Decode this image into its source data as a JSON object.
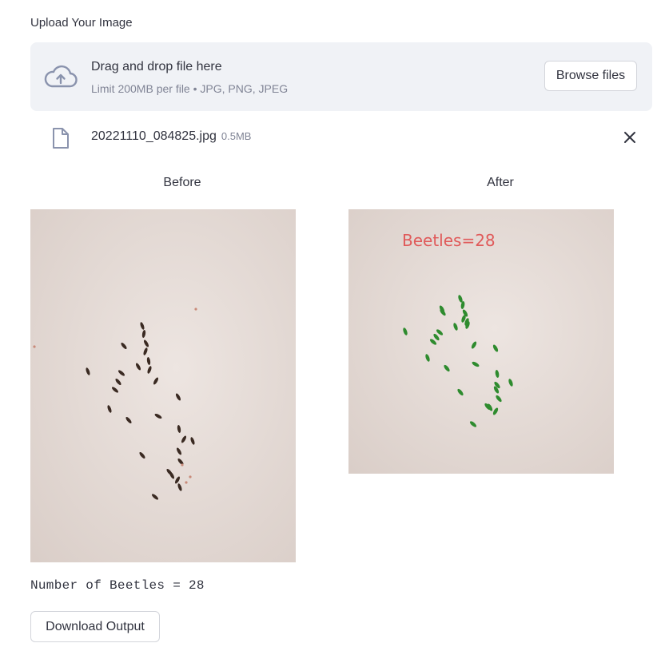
{
  "uploader": {
    "label": "Upload Your Image",
    "drop_title": "Drag and drop file here",
    "drop_subtitle": "Limit 200MB per file • JPG, PNG, JPEG",
    "browse_label": "Browse files",
    "cloud_icon": "cloud-upload-icon"
  },
  "file": {
    "name": "20221110_084825.jpg",
    "size": "0.5MB",
    "file_icon": "file-icon",
    "remove_icon": "close-icon"
  },
  "columns": {
    "before_title": "Before",
    "after_title": "After"
  },
  "after_overlay_text": "Beetles=28",
  "result_text": "Number of Beetles = 28",
  "download_label": "Download Output",
  "colors": {
    "dropzone_bg": "#f0f2f6",
    "detection_green": "#2e8b2e",
    "overlay_red": "#e05a5a",
    "beetle_dark": "#3a2a22"
  }
}
